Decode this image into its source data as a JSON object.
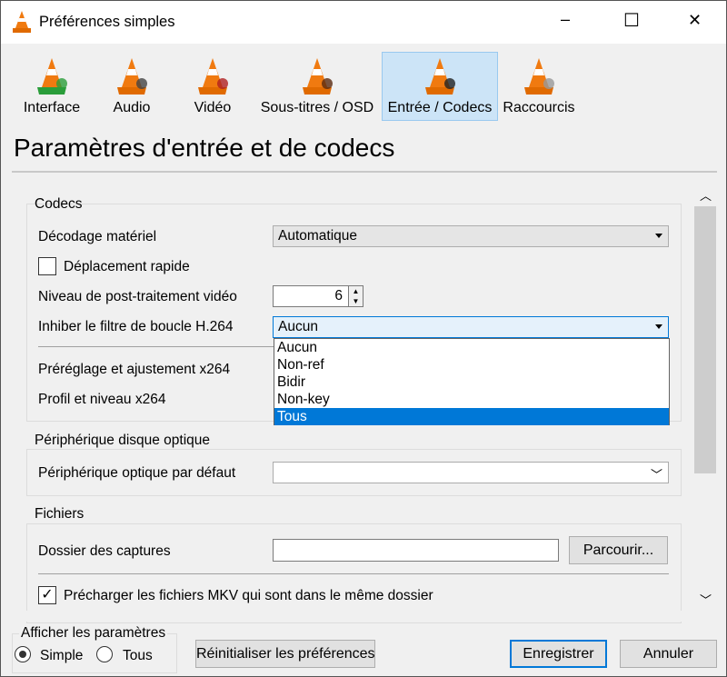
{
  "window": {
    "title": "Préférences simples",
    "controls": {
      "minimize": "–",
      "maximize": "☐",
      "close": "✕"
    }
  },
  "tabs": [
    {
      "label": "Interface",
      "icon": "vlc-cone-interface-icon"
    },
    {
      "label": "Audio",
      "icon": "vlc-cone-headphones-icon"
    },
    {
      "label": "Vidéo",
      "icon": "vlc-cone-glasses-icon"
    },
    {
      "label": "Sous-titres / OSD",
      "icon": "vlc-cone-subtitles-icon"
    },
    {
      "label": "Entrée / Codecs",
      "icon": "vlc-cone-cables-icon",
      "selected": true
    },
    {
      "label": "Raccourcis",
      "icon": "vlc-cone-hotkeys-icon"
    }
  ],
  "page_title": "Paramètres d'entrée et de codecs",
  "codecs": {
    "title": "Codecs",
    "hw_decoding": {
      "label": "Décodage matériel",
      "value": "Automatique"
    },
    "fast_seek": {
      "label": "Déplacement rapide",
      "checked": false
    },
    "postproc": {
      "label": "Niveau de post-traitement vidéo",
      "value": "6"
    },
    "h264_loop": {
      "label": "Inhiber le filtre de boucle H.264",
      "value": "Aucun",
      "options": [
        "Aucun",
        "Non-ref",
        "Bidir",
        "Non-key",
        "Tous"
      ],
      "highlighted": "Tous"
    },
    "x264_preset": {
      "label": "Préréglage et ajustement x264"
    },
    "x264_profile": {
      "label": "Profil et niveau x264"
    }
  },
  "optical": {
    "title": "Périphérique disque optique",
    "device": {
      "label": "Périphérique optique par défaut",
      "value": ""
    }
  },
  "files": {
    "title": "Fichiers",
    "snapshots": {
      "label": "Dossier des captures",
      "value": "",
      "browse": "Parcourir..."
    },
    "mkv": {
      "label": "Précharger les fichiers MKV qui sont dans le même dossier",
      "checked": true
    }
  },
  "show_settings": {
    "title": "Afficher les paramètres",
    "simple": "Simple",
    "all": "Tous",
    "selected": "Simple"
  },
  "buttons": {
    "reset": "Réinitialiser les préférences",
    "save": "Enregistrer",
    "cancel": "Annuler"
  },
  "colors": {
    "accent": "#0078d7",
    "tab_selected": "#cce4f7",
    "cone": "#f07a10"
  }
}
